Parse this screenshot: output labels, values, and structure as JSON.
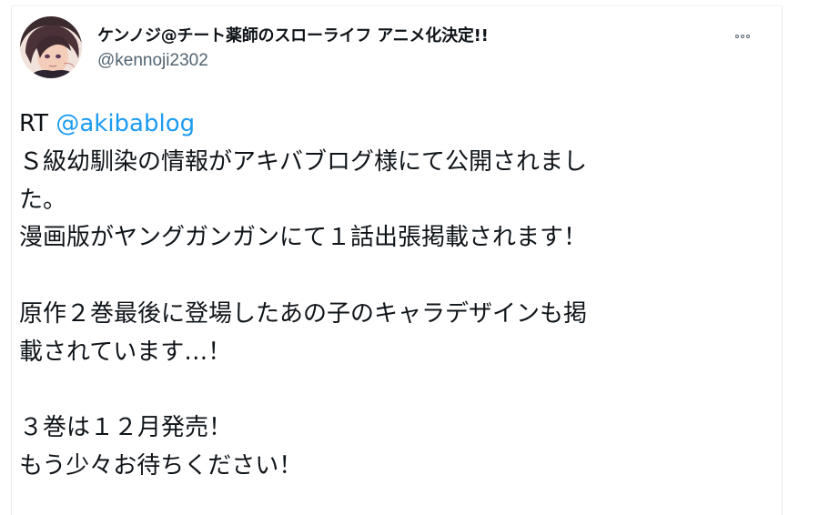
{
  "tweet": {
    "author": {
      "display_name": "ケンノジ@チート薬師のスローライフ アニメ化決定!!",
      "handle": "@kennoji2302",
      "avatar_icon": "user-avatar"
    },
    "more_icon": "more-horizontal-icon",
    "body": {
      "rt_prefix": "RT ",
      "mention": "@akibablog",
      "lines": [
        "Ｓ級幼馴染の情報がアキバブログ様にて公開されまし",
        "た。",
        "漫画版がヤングガンガンにて１話出張掲載されます！",
        "",
        "原作２巻最後に登場したあの子のキャラデザインも掲",
        "載されています…！",
        "",
        "３巻は１２月発売！",
        "もう少々お待ちください！"
      ]
    }
  },
  "colors": {
    "text": "#0f1419",
    "secondary_text": "#536471",
    "link": "#1d9bf0",
    "border": "#e6ecf0"
  }
}
